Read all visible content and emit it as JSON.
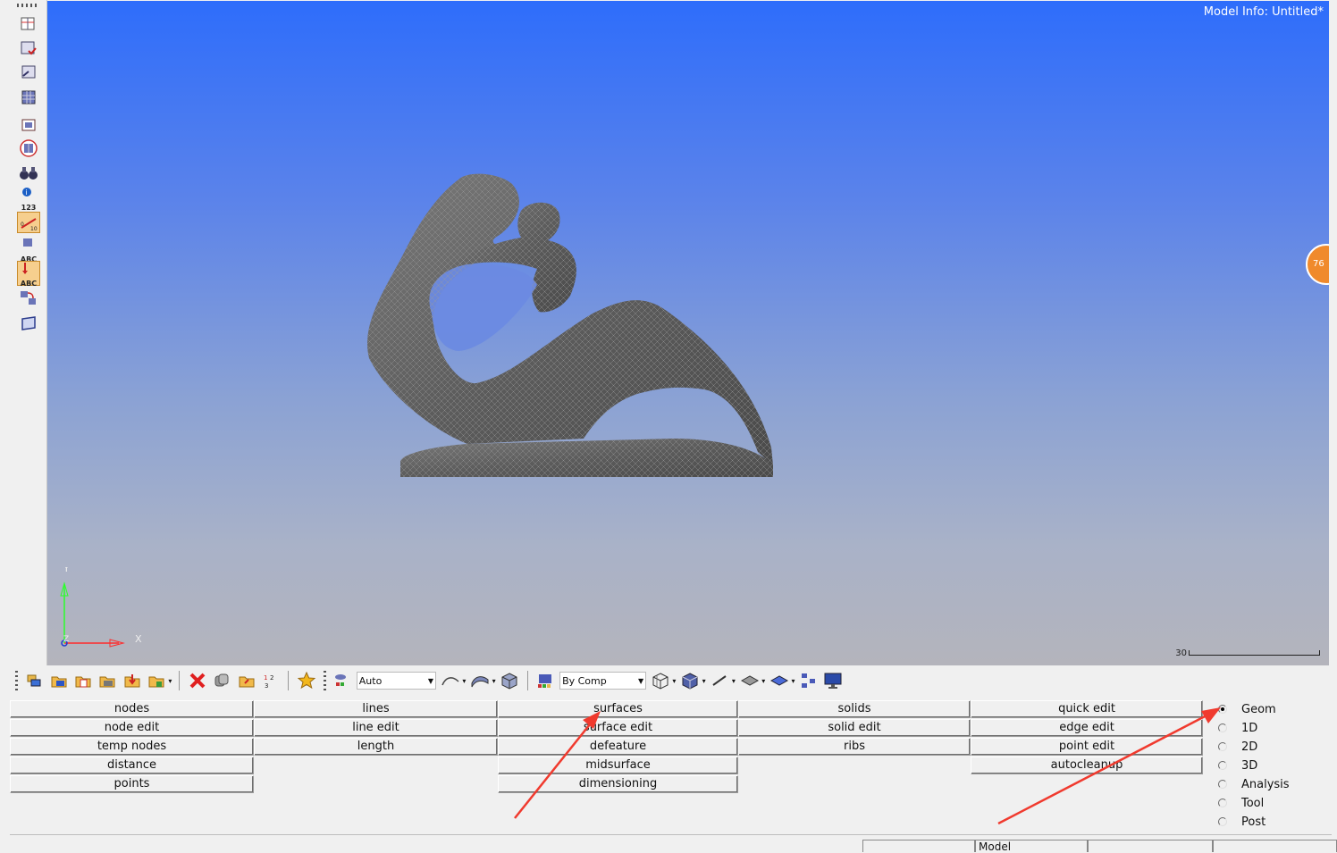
{
  "viewport": {
    "model_info": "Model Info: Untitled*",
    "scale_label": "30",
    "triad": {
      "x": "X",
      "y": "Y",
      "z": "Z"
    },
    "badge_text": "76"
  },
  "left_toolbar": {
    "icons": [
      {
        "name": "window-grid-icon"
      },
      {
        "name": "window-check-icon"
      },
      {
        "name": "window-arrow-icon"
      },
      {
        "name": "window-mesh-icon"
      },
      {
        "name": "window-frame-icon"
      },
      {
        "name": "mesh-circle-icon"
      },
      {
        "name": "binoculars-icon"
      },
      {
        "name": "info-123-icon",
        "label": "123"
      },
      {
        "name": "ruler-icon"
      },
      {
        "name": "label-abc-icon",
        "label": "ABC"
      },
      {
        "name": "label-abc-active-icon",
        "label": "ABC"
      },
      {
        "name": "transform-icon"
      },
      {
        "name": "frame-blue-icon"
      }
    ]
  },
  "bottom_toolbar": {
    "auto_dropdown": "Auto",
    "color_mode_dropdown": "By Comp"
  },
  "panel": {
    "columns": [
      [
        "nodes",
        "node edit",
        "temp nodes",
        "distance",
        "points"
      ],
      [
        "lines",
        "line edit",
        "length"
      ],
      [
        "surfaces",
        "surface edit",
        "defeature",
        "midsurface",
        "dimensioning"
      ],
      [
        "solids",
        "solid edit",
        "ribs"
      ],
      [
        "quick edit",
        "edge edit",
        "point edit",
        "autocleanup"
      ]
    ],
    "radio_options": [
      "Geom",
      "1D",
      "2D",
      "3D",
      "Analysis",
      "Tool",
      "Post"
    ],
    "selected_radio": "Geom"
  },
  "status_bar": {
    "model_label": "Model"
  },
  "colors": {
    "annotation_arrow": "#f03a2e",
    "viewport_top": "#2e6dfb",
    "viewport_bottom": "#b4b4bc"
  }
}
